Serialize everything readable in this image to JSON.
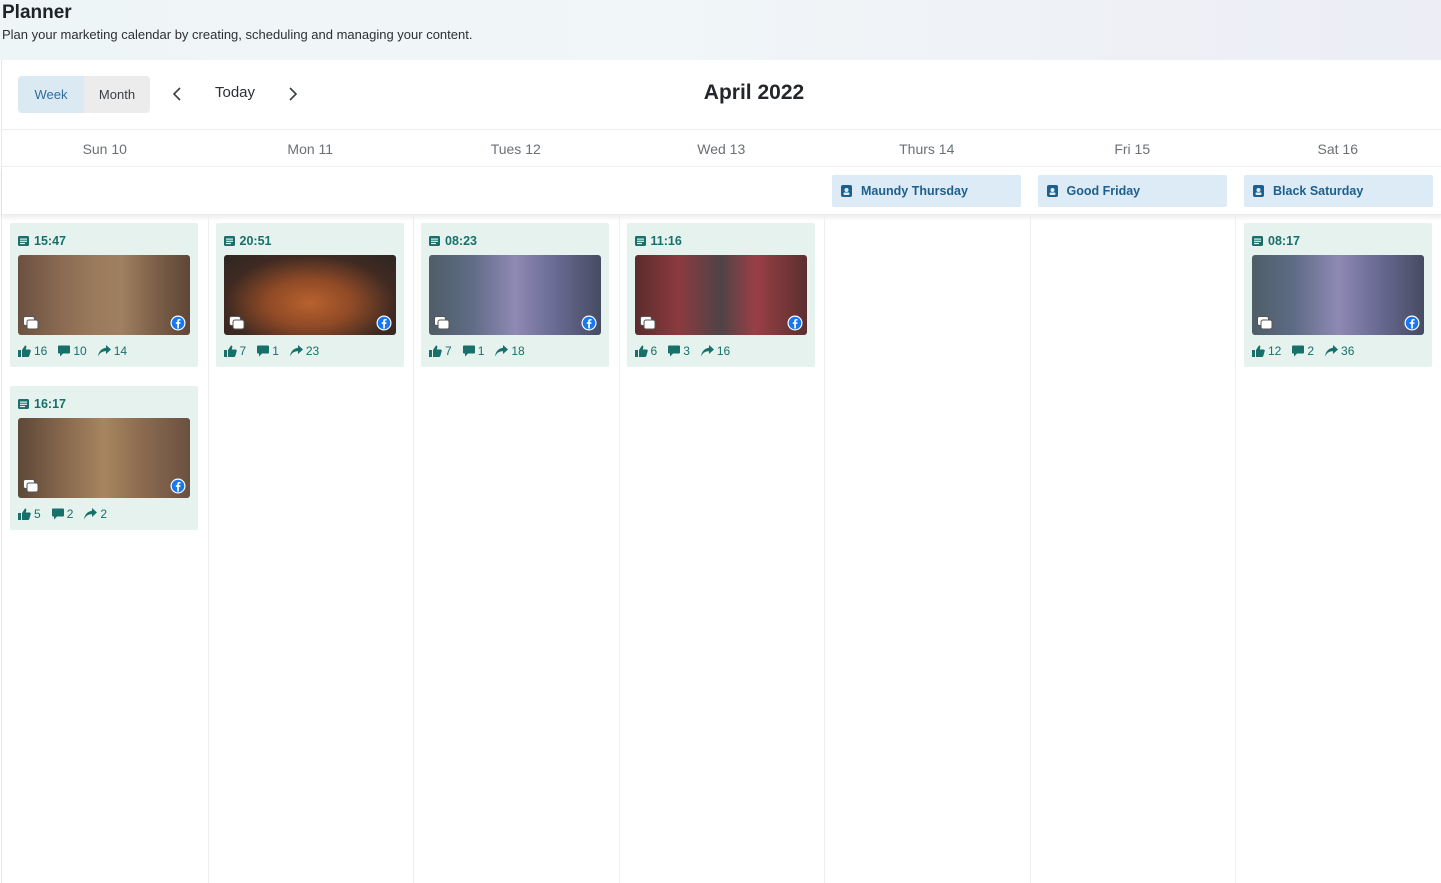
{
  "header": {
    "title": "Planner",
    "subtitle": "Plan your marketing calendar by creating, scheduling and managing your content."
  },
  "toolbar": {
    "view_week": "Week",
    "view_month": "Month",
    "today": "Today",
    "month_title": "April 2022",
    "active_view": "Week"
  },
  "days": [
    "Sun 10",
    "Mon 11",
    "Tues 12",
    "Wed 13",
    "Thurs 14",
    "Fri 15",
    "Sat 16"
  ],
  "events": [
    {
      "day": 4,
      "label": "Maundy Thursday"
    },
    {
      "day": 5,
      "label": "Good Friday"
    },
    {
      "day": 6,
      "label": "Black Saturday"
    }
  ],
  "posts": [
    {
      "day": 0,
      "slot": 0,
      "time": "15:47",
      "likes": "16",
      "comments": "10",
      "shares": "14",
      "thumb": "brown-dress"
    },
    {
      "day": 0,
      "slot": 1,
      "time": "16:17",
      "likes": "5",
      "comments": "2",
      "shares": "2",
      "thumb": "brown-dress-2"
    },
    {
      "day": 1,
      "slot": 0,
      "time": "20:51",
      "likes": "7",
      "comments": "1",
      "shares": "23",
      "thumb": "orange-fringe"
    },
    {
      "day": 2,
      "slot": 0,
      "time": "08:23",
      "likes": "7",
      "comments": "1",
      "shares": "18",
      "thumb": "purple-dress"
    },
    {
      "day": 3,
      "slot": 0,
      "time": "11:16",
      "likes": "6",
      "comments": "3",
      "shares": "16",
      "thumb": "red-pants"
    },
    {
      "day": 6,
      "slot": 0,
      "time": "08:17",
      "likes": "12",
      "comments": "2",
      "shares": "36",
      "thumb": "purple-dress"
    }
  ],
  "colors": {
    "accent": "#17706a",
    "event_bg": "#dcebf5",
    "event_text": "#1d5f8e",
    "post_bg": "#e6f2ee",
    "facebook": "#1877f2"
  }
}
